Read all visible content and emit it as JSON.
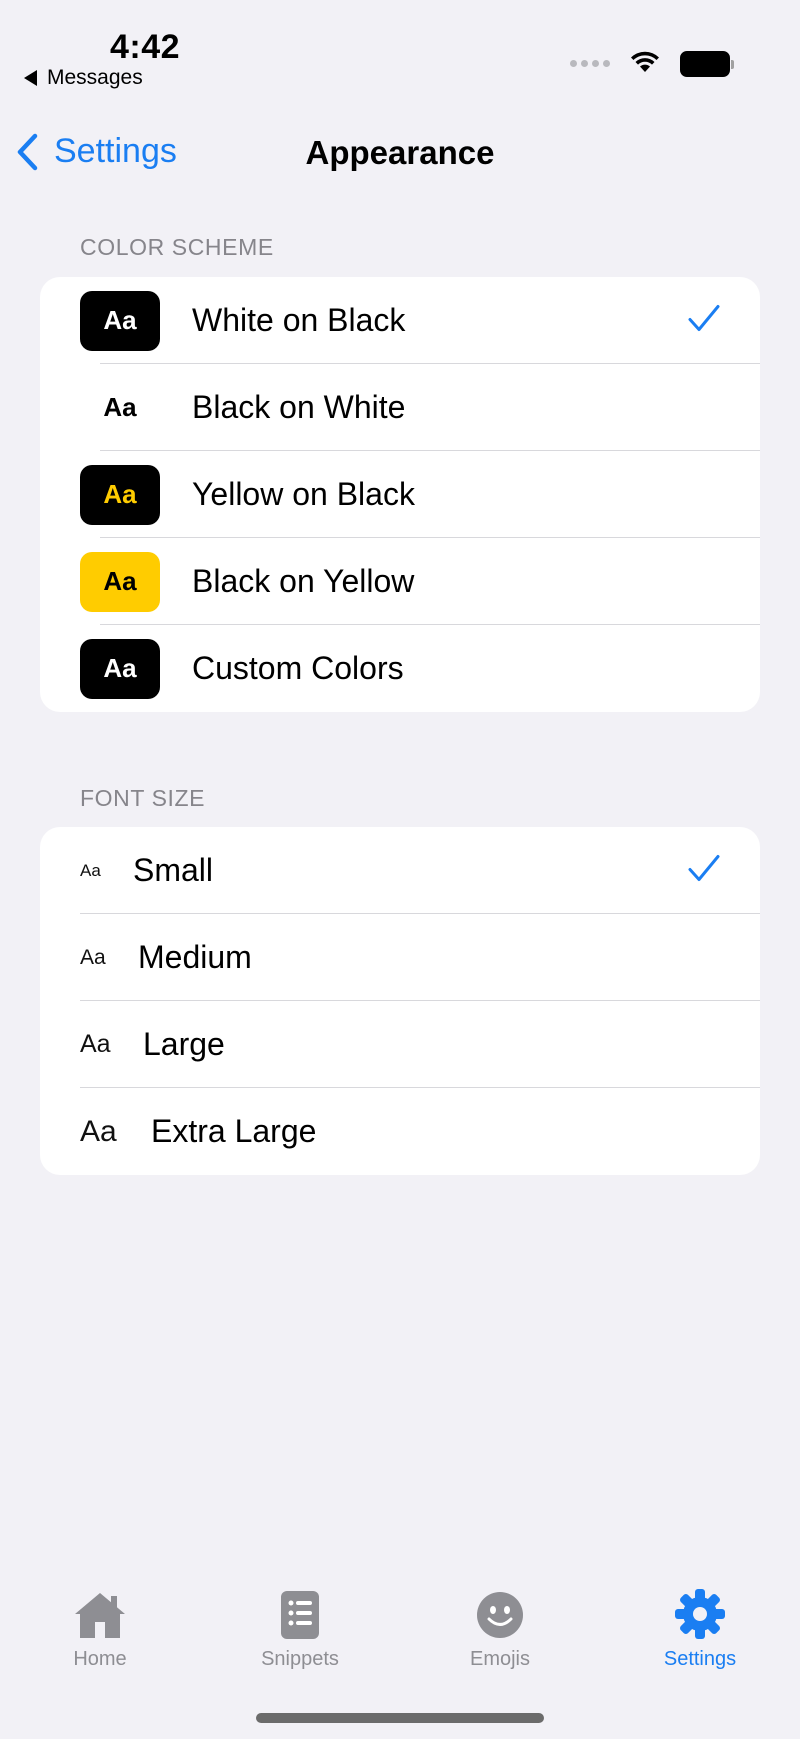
{
  "status_bar": {
    "time": "4:42",
    "back_app": "Messages"
  },
  "nav": {
    "back_label": "Settings",
    "title": "Appearance"
  },
  "color_scheme": {
    "header": "COLOR SCHEME",
    "items": [
      {
        "label": "White on Black",
        "swatch_text": "Aa",
        "swatch_bg": "#000000",
        "swatch_fg": "#ffffff",
        "selected": true
      },
      {
        "label": "Black on White",
        "swatch_text": "Aa",
        "swatch_bg": "#ffffff",
        "swatch_fg": "#000000",
        "selected": false
      },
      {
        "label": "Yellow on Black",
        "swatch_text": "Aa",
        "swatch_bg": "#000000",
        "swatch_fg": "#ffcc00",
        "selected": false
      },
      {
        "label": "Black on Yellow",
        "swatch_text": "Aa",
        "swatch_bg": "#ffcc00",
        "swatch_fg": "#000000",
        "selected": false
      },
      {
        "label": "Custom Colors",
        "swatch_text": "Aa",
        "swatch_bg": "#000000",
        "swatch_fg": "#ffffff",
        "selected": false
      }
    ]
  },
  "font_size": {
    "header": "FONT SIZE",
    "items": [
      {
        "label": "Small",
        "sample": "Aa",
        "selected": true
      },
      {
        "label": "Medium",
        "sample": "Aa",
        "selected": false
      },
      {
        "label": "Large",
        "sample": "Aa",
        "selected": false
      },
      {
        "label": "Extra Large",
        "sample": "Aa",
        "selected": false
      }
    ]
  },
  "tabs": [
    {
      "label": "Home",
      "icon": "house-icon",
      "active": false
    },
    {
      "label": "Snippets",
      "icon": "list-icon",
      "active": false
    },
    {
      "label": "Emojis",
      "icon": "smiley-icon",
      "active": false
    },
    {
      "label": "Settings",
      "icon": "gear-icon",
      "active": true
    }
  ],
  "colors": {
    "accent": "#1a7ef2",
    "background": "#f2f1f6",
    "inactive_tab": "#8e8e93"
  }
}
